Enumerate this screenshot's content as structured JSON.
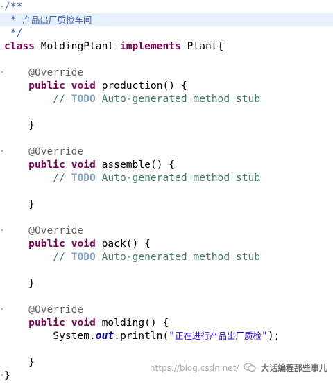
{
  "editor": {
    "lines": [
      {
        "parts": [
          {
            "t": "/**",
            "c": "jd"
          }
        ]
      },
      {
        "parts": [
          {
            "t": " * ",
            "c": "jd"
          },
          {
            "t": "产品出厂质检车间",
            "c": "jd cjk"
          }
        ],
        "highlight": true
      },
      {
        "parts": [
          {
            "t": " */",
            "c": "jd"
          }
        ]
      },
      {
        "parts": [
          {
            "t": "class",
            "c": "kw"
          },
          {
            "t": " MoldingPlant ",
            "c": ""
          },
          {
            "t": "implements",
            "c": "kw"
          },
          {
            "t": " Plant{",
            "c": ""
          }
        ]
      },
      {
        "parts": []
      },
      {
        "parts": [
          {
            "t": "    ",
            "c": ""
          },
          {
            "t": "@Override",
            "c": "ann"
          }
        ]
      },
      {
        "parts": [
          {
            "t": "    ",
            "c": ""
          },
          {
            "t": "public",
            "c": "kw"
          },
          {
            "t": " ",
            "c": ""
          },
          {
            "t": "void",
            "c": "kw"
          },
          {
            "t": " production() {",
            "c": ""
          }
        ]
      },
      {
        "parts": [
          {
            "t": "        ",
            "c": ""
          },
          {
            "t": "// ",
            "c": "cm"
          },
          {
            "t": "TODO",
            "c": "todo"
          },
          {
            "t": " Auto-generated method stub",
            "c": "cm"
          }
        ]
      },
      {
        "parts": []
      },
      {
        "parts": [
          {
            "t": "    }",
            "c": ""
          }
        ]
      },
      {
        "parts": []
      },
      {
        "parts": [
          {
            "t": "    ",
            "c": ""
          },
          {
            "t": "@Override",
            "c": "ann"
          }
        ]
      },
      {
        "parts": [
          {
            "t": "    ",
            "c": ""
          },
          {
            "t": "public",
            "c": "kw"
          },
          {
            "t": " ",
            "c": ""
          },
          {
            "t": "void",
            "c": "kw"
          },
          {
            "t": " assemble() {",
            "c": ""
          }
        ]
      },
      {
        "parts": [
          {
            "t": "        ",
            "c": ""
          },
          {
            "t": "// ",
            "c": "cm"
          },
          {
            "t": "TODO",
            "c": "todo"
          },
          {
            "t": " Auto-generated method stub",
            "c": "cm"
          }
        ]
      },
      {
        "parts": []
      },
      {
        "parts": [
          {
            "t": "    }",
            "c": ""
          }
        ]
      },
      {
        "parts": []
      },
      {
        "parts": [
          {
            "t": "    ",
            "c": ""
          },
          {
            "t": "@Override",
            "c": "ann"
          }
        ]
      },
      {
        "parts": [
          {
            "t": "    ",
            "c": ""
          },
          {
            "t": "public",
            "c": "kw"
          },
          {
            "t": " ",
            "c": ""
          },
          {
            "t": "void",
            "c": "kw"
          },
          {
            "t": " pack() {",
            "c": ""
          }
        ]
      },
      {
        "parts": [
          {
            "t": "        ",
            "c": ""
          },
          {
            "t": "// ",
            "c": "cm"
          },
          {
            "t": "TODO",
            "c": "todo"
          },
          {
            "t": " Auto-generated method stub",
            "c": "cm"
          }
        ]
      },
      {
        "parts": []
      },
      {
        "parts": [
          {
            "t": "    }",
            "c": ""
          }
        ]
      },
      {
        "parts": []
      },
      {
        "parts": [
          {
            "t": "    ",
            "c": ""
          },
          {
            "t": "@Override",
            "c": "ann"
          }
        ]
      },
      {
        "parts": [
          {
            "t": "    ",
            "c": ""
          },
          {
            "t": "public",
            "c": "kw"
          },
          {
            "t": " ",
            "c": ""
          },
          {
            "t": "void",
            "c": "kw"
          },
          {
            "t": " molding() {",
            "c": ""
          }
        ]
      },
      {
        "parts": [
          {
            "t": "        System.",
            "c": ""
          },
          {
            "t": "out",
            "c": "fld"
          },
          {
            "t": ".println(",
            "c": ""
          },
          {
            "t": "\"",
            "c": "str"
          },
          {
            "t": "正在进行产品出厂质检",
            "c": "str cjk"
          },
          {
            "t": "\"",
            "c": "str"
          },
          {
            "t": ");",
            "c": ""
          }
        ]
      },
      {
        "parts": []
      },
      {
        "parts": [
          {
            "t": "    }",
            "c": ""
          }
        ]
      },
      {
        "parts": [
          {
            "t": "}",
            "c": ""
          }
        ]
      }
    ],
    "fold_lines": [
      0,
      5,
      11,
      17,
      23,
      28
    ],
    "colors": {
      "background": "#ffffff",
      "current_line": "#e8f2fe",
      "keyword": "#7f0055",
      "comment": "#3f7f5f",
      "javadoc": "#3f5fbf",
      "annotation": "#646464",
      "todo": "#7f9fbf",
      "string": "#2a00ff",
      "field": "#0000c0"
    }
  },
  "watermark": {
    "url": "https://blog.csdn.net/",
    "account": "大话编程那些事儿",
    "icon": "wechat-logo-icon"
  }
}
